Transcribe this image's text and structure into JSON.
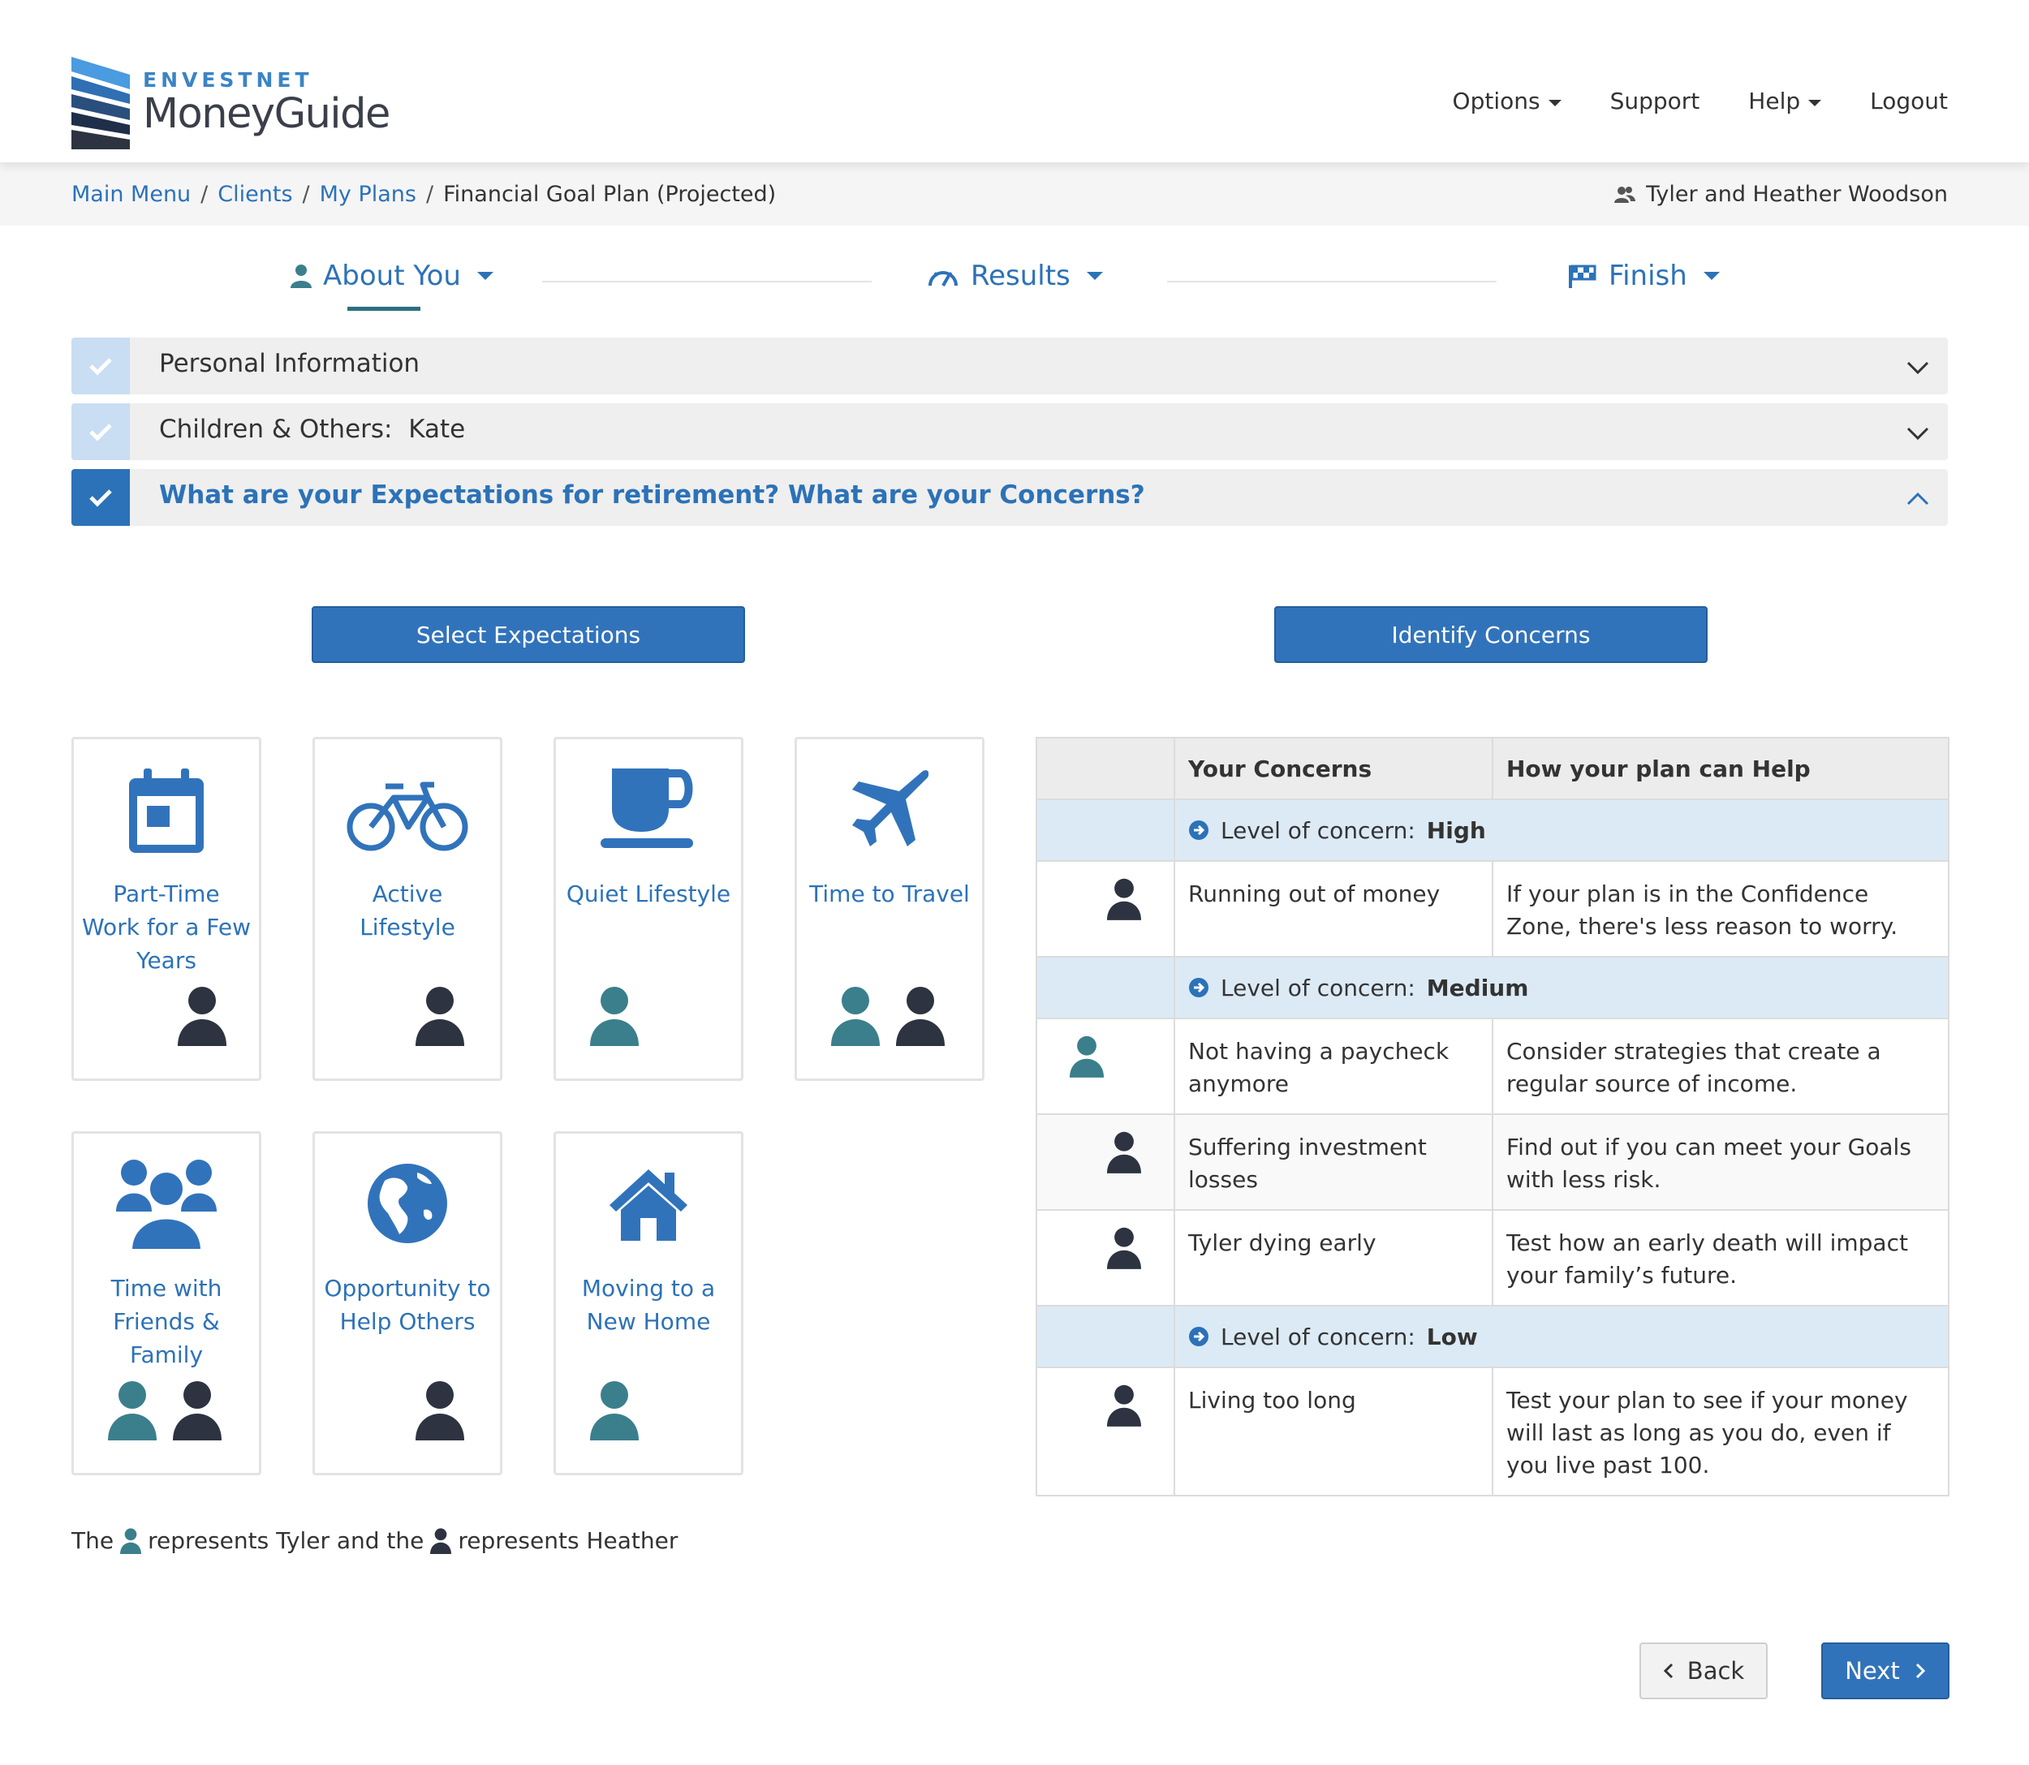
{
  "brand": {
    "top": "ENVESTNET",
    "bottom": "MoneyGuide",
    "accent": "#3173bb"
  },
  "topnav": {
    "options": "Options",
    "support": "Support",
    "help": "Help",
    "logout": "Logout"
  },
  "breadcrumb": {
    "main_menu": "Main Menu",
    "clients": "Clients",
    "my_plans": "My Plans",
    "current": "Financial Goal Plan (Projected)"
  },
  "client": {
    "name": "Tyler and Heather Woodson"
  },
  "steps": {
    "about": "About You",
    "results": "Results",
    "finish": "Finish"
  },
  "accordion": {
    "personal": "Personal Information",
    "children_label": "Children & Others:",
    "children_value": "Kate",
    "expectations": "What are your Expectations for retirement? What are your Concerns?"
  },
  "buttons": {
    "select_expectations": "Select Expectations",
    "identify_concerns": "Identify Concerns",
    "back": "Back",
    "next": "Next"
  },
  "expectations": [
    {
      "label": "Part-Time Work for a Few Years",
      "icon": "calendar-icon",
      "people": [
        "heather"
      ]
    },
    {
      "label": "Active Lifestyle",
      "icon": "bicycle-icon",
      "people": [
        "heather"
      ]
    },
    {
      "label": "Quiet Lifestyle",
      "icon": "coffee-cup-icon",
      "people": [
        "tyler"
      ]
    },
    {
      "label": "Time to Travel",
      "icon": "airplane-icon",
      "people": [
        "tyler",
        "heather"
      ]
    },
    {
      "label": "Time with Friends & Family",
      "icon": "group-icon",
      "people": [
        "tyler",
        "heather"
      ]
    },
    {
      "label": "Opportunity to Help Others",
      "icon": "globe-icon",
      "people": [
        "heather"
      ]
    },
    {
      "label": "Moving to a New Home",
      "icon": "house-icon",
      "people": [
        "tyler"
      ]
    }
  ],
  "concerns": {
    "headers": {
      "concern": "Your Concerns",
      "help": "How your plan can Help"
    },
    "level_prefix": "Level of concern:",
    "levels": [
      {
        "level": "High",
        "rows": [
          {
            "person": "heather",
            "concern": "Running out of money",
            "help": "If your plan is in the Confidence Zone, there's less reason to worry."
          }
        ]
      },
      {
        "level": "Medium",
        "rows": [
          {
            "person": "tyler",
            "concern": "Not having a paycheck anymore",
            "help": "Consider strategies that create a regular source of income."
          },
          {
            "person": "heather",
            "concern": "Suffering investment losses",
            "help": "Find out if you can meet your Goals with less risk."
          },
          {
            "person": "heather",
            "concern": "Tyler dying early",
            "help": "Test how an early death will impact your family’s future."
          }
        ]
      },
      {
        "level": "Low",
        "rows": [
          {
            "person": "heather",
            "concern": "Living too long",
            "help": "Test your plan to see if your money will last as long as you do, even if you live past 100."
          }
        ]
      }
    ]
  },
  "legend": {
    "the": "The",
    "tyler": "represents Tyler and the",
    "heather": "represents Heather"
  },
  "colors": {
    "tyler": "#3b7f8c",
    "heather": "#2d3340",
    "link": "#2c72b8"
  }
}
